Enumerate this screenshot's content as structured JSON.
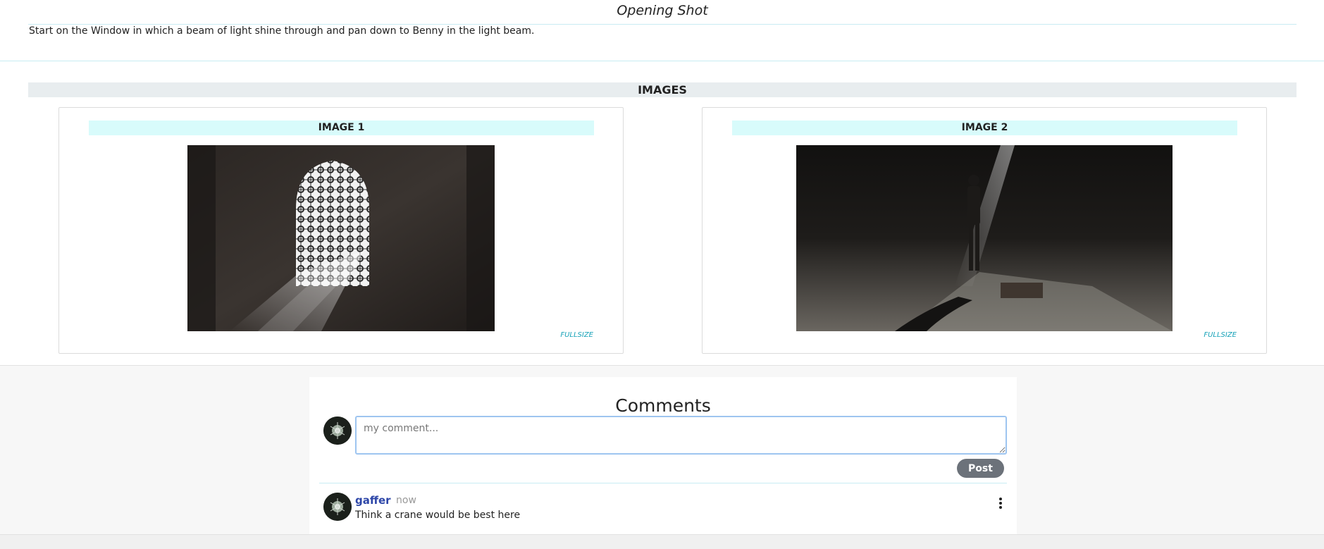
{
  "shot": {
    "title": "Opening Shot",
    "description": "Start on the Window in which a beam of light shine through and pan down to Benny in the light beam."
  },
  "images_section": {
    "heading": "IMAGES",
    "cards": [
      {
        "title": "IMAGE 1",
        "fullsize_label": "FULLSIZE"
      },
      {
        "title": "IMAGE 2",
        "fullsize_label": "FULLSIZE"
      }
    ]
  },
  "comments": {
    "heading": "Comments",
    "input_placeholder": "my comment...",
    "input_value": "",
    "post_label": "Post",
    "items": [
      {
        "author": "gaffer",
        "time": "now",
        "text": "Think a crane would be best here"
      }
    ]
  },
  "colors": {
    "accent_cyan": "#17a2b8",
    "author_blue": "#2d46a8",
    "post_button": "#6c727a",
    "card_title_bg": "#d8fbfb"
  }
}
